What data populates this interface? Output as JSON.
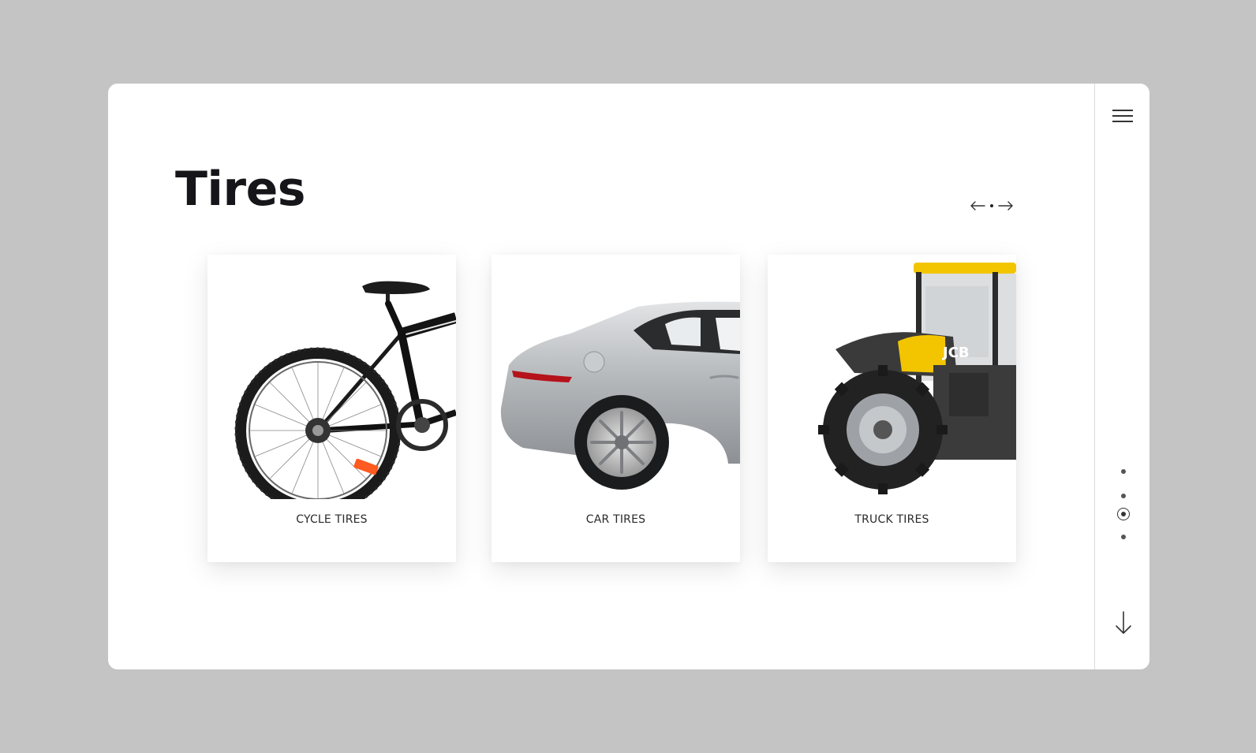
{
  "page": {
    "title": "Tires"
  },
  "slider": {
    "prev_icon": "arrow-left-icon",
    "next_icon": "arrow-right-icon"
  },
  "cards": [
    {
      "label": "CYCLE TIRES",
      "image": "bicycle-image"
    },
    {
      "label": "CAR TIRES",
      "image": "car-image"
    },
    {
      "label": "TRUCK TIRES",
      "image": "tractor-image"
    }
  ],
  "sidebar": {
    "menu_icon": "hamburger-menu-icon",
    "section_count": 4,
    "active_section": 3,
    "scroll_icon": "arrow-down-icon"
  },
  "colors": {
    "background": "#c4c4c4",
    "panel": "#ffffff",
    "text": "#16161a",
    "accent_yellow": "#f2c500"
  }
}
